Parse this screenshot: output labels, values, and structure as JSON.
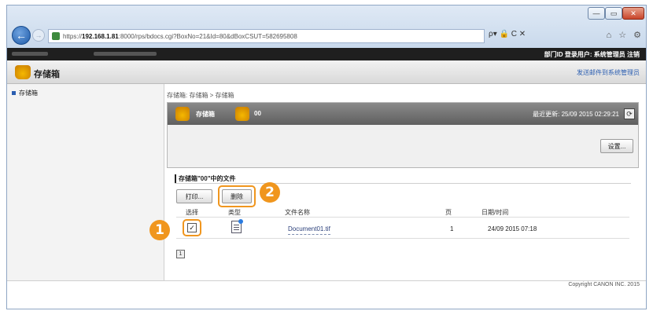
{
  "browser": {
    "url_prefix": "https://",
    "url_host": "192.168.1.81",
    "url_rest": ":8000/rps/bdocs.cgi?BoxNo=21&Id=80&dBoxCSUT=582695808",
    "address_tools": "ρ▾ 🔒 C ✕",
    "window_controls": {
      "minimize": "—",
      "maximize": "▭",
      "close": "✕"
    }
  },
  "topbar": {
    "links": "部门ID  登录用户: 系统管理员  注销"
  },
  "header": {
    "title": "存储箱",
    "link": "发送邮件到系统管理员"
  },
  "sidebar": {
    "items": [
      {
        "label": "存储箱"
      }
    ]
  },
  "breadcrumb": "存储箱: 存储箱 > 存储箱",
  "panel": {
    "title": "存储箱",
    "number": "00",
    "last_updated": "最近更新: 25/09 2015 02:29:21",
    "refresh_icon": "⟳",
    "settings_label": "设置..."
  },
  "section": {
    "title": "存储箱\"00\"中的文件"
  },
  "actions": {
    "print_label": "打印...",
    "delete_label": "删除"
  },
  "table": {
    "headers": {
      "select": "选择",
      "type": "类型",
      "name": "文件名称",
      "pages": "页",
      "datetime": "日期/时间"
    },
    "rows": [
      {
        "selected": true,
        "check_mark": "✓",
        "type_icon": "document-icon",
        "name": "Document01.tif",
        "pages": "1",
        "datetime": "24/09 2015 07:18"
      }
    ]
  },
  "pager": {
    "label": "1"
  },
  "callouts": {
    "one": "1",
    "two": "2"
  },
  "footer": {
    "copyright": "Copyright CANON INC. 2015"
  },
  "colors": {
    "callout": "#f0961e",
    "link": "#2a5db0",
    "panel_header": "#6b6b6b",
    "app_icon": "#f5b800"
  }
}
